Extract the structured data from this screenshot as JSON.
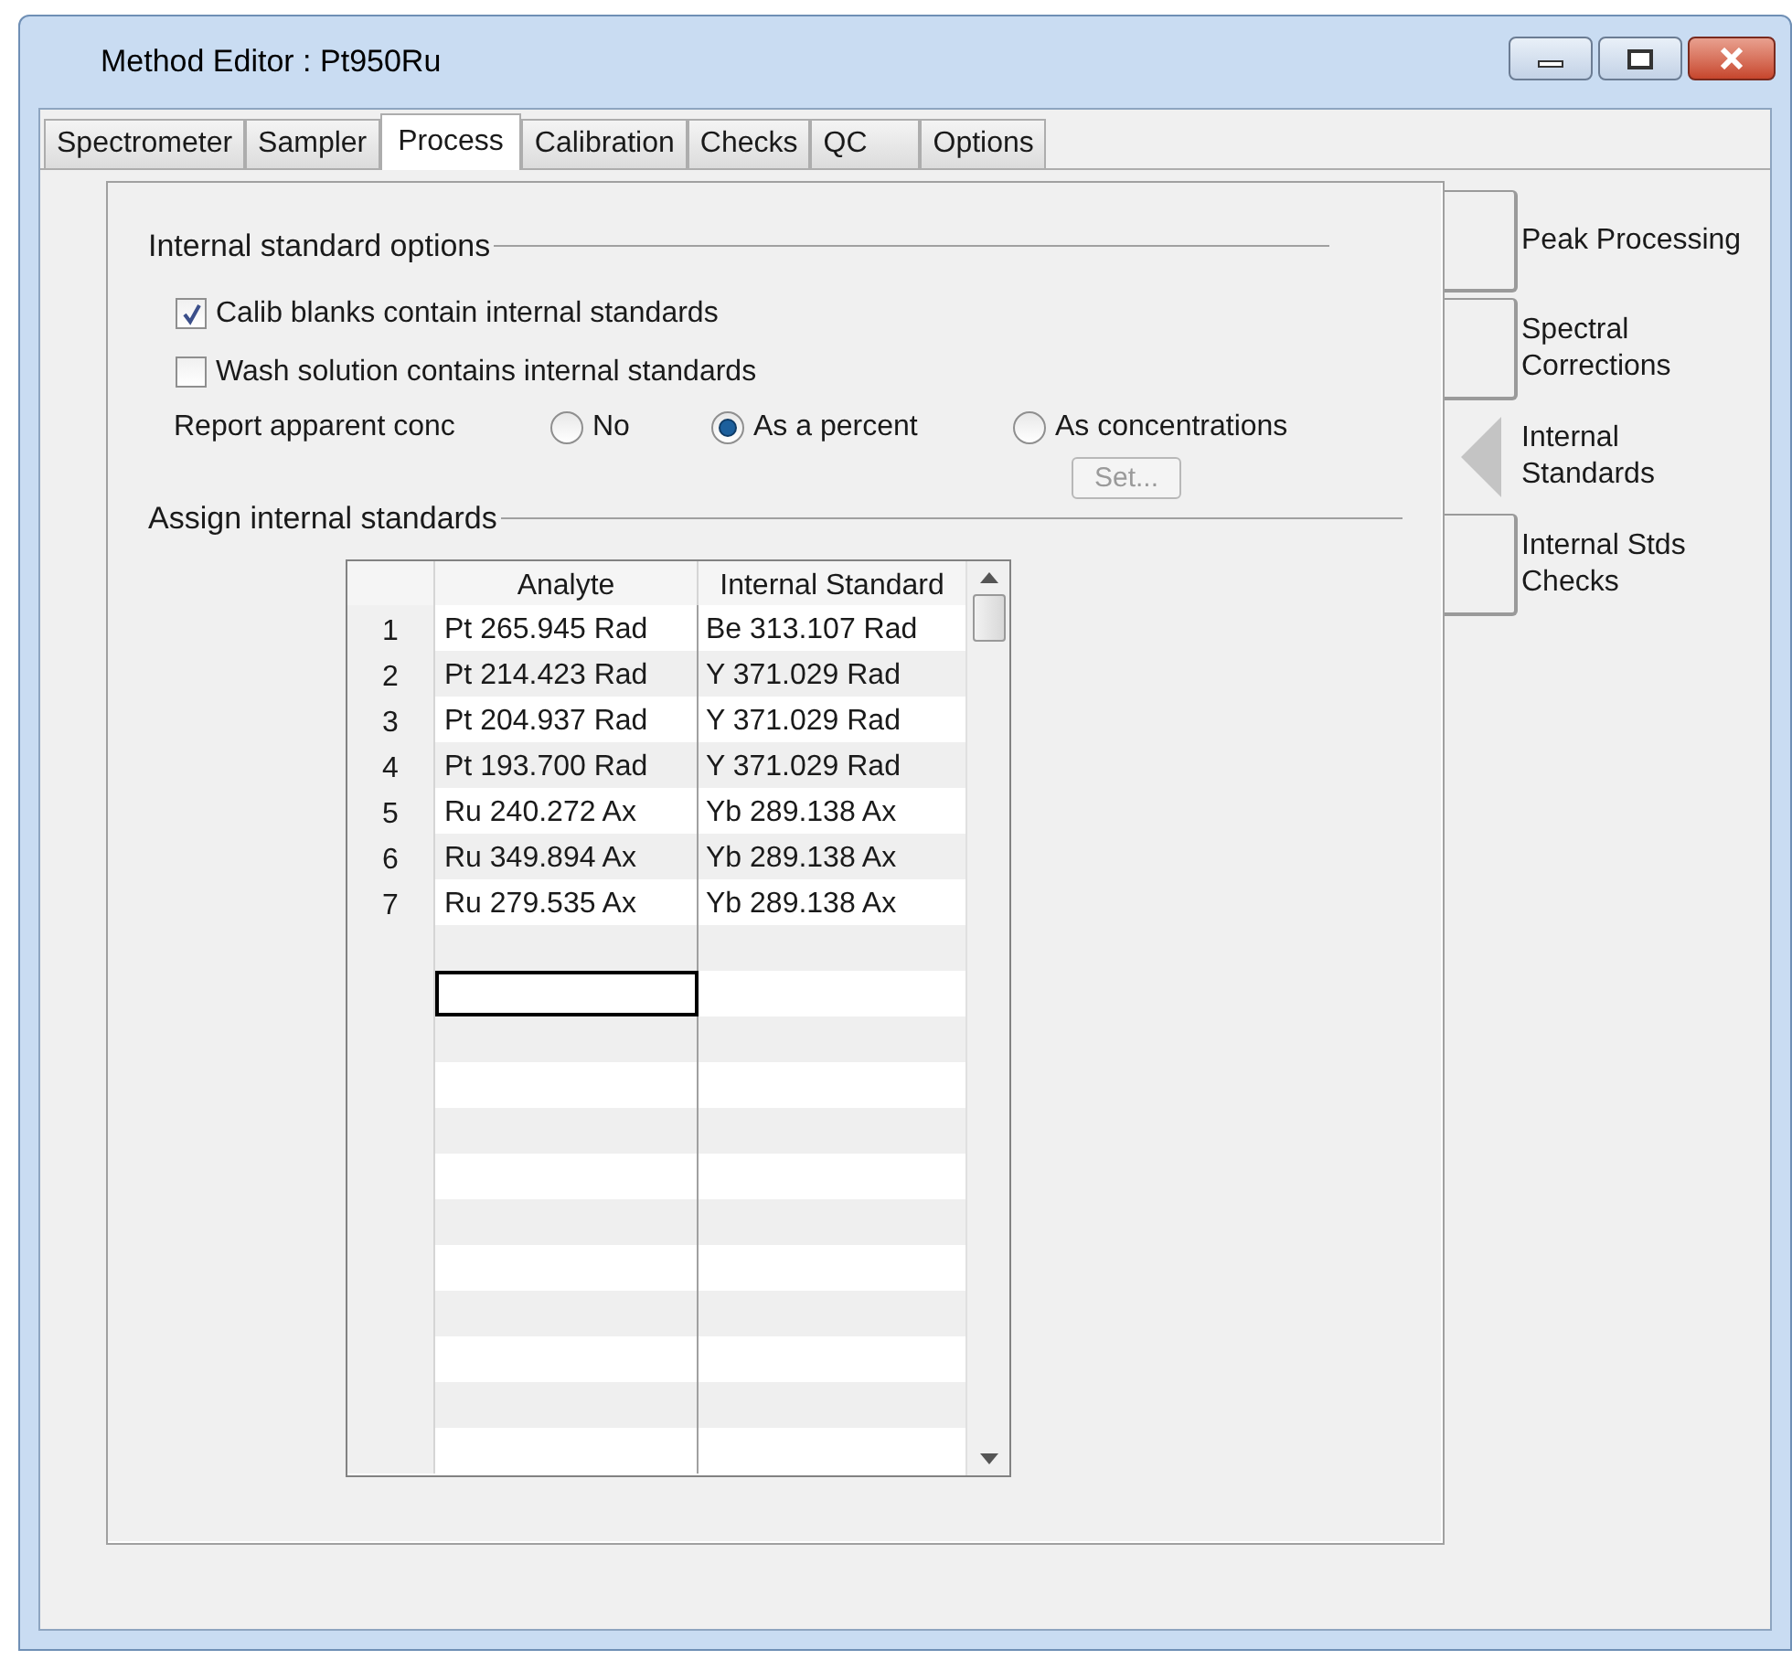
{
  "window": {
    "title": "Method Editor : Pt950Ru"
  },
  "tabs": [
    {
      "label": "Spectrometer",
      "selected": false
    },
    {
      "label": "Sampler",
      "selected": false
    },
    {
      "label": "Process",
      "selected": true
    },
    {
      "label": "Calibration",
      "selected": false
    },
    {
      "label": "Checks",
      "selected": false
    },
    {
      "label": "QC",
      "selected": false
    },
    {
      "label": "Options",
      "selected": false
    }
  ],
  "options": {
    "title": "Internal standard options",
    "checkboxes": [
      {
        "label": "Calib blanks contain internal standards",
        "checked": true
      },
      {
        "label": "Wash solution contains internal standards",
        "checked": false
      }
    ],
    "report_label": "Report apparent conc",
    "radios": [
      {
        "label": "No",
        "selected": false
      },
      {
        "label": "As a percent",
        "selected": true
      },
      {
        "label": "As concentrations",
        "selected": false
      }
    ],
    "set_button": {
      "label": "Set...",
      "disabled": true
    }
  },
  "assign": {
    "title": "Assign internal standards",
    "columns": [
      "Analyte",
      "Internal Standard"
    ],
    "rows": [
      {
        "index": "1",
        "analyte": "Pt 265.945 Rad",
        "standard": "Be 313.107 Rad"
      },
      {
        "index": "2",
        "analyte": "Pt 214.423 Rad",
        "standard": "Y 371.029 Rad"
      },
      {
        "index": "3",
        "analyte": "Pt 204.937 Rad",
        "standard": "Y 371.029 Rad"
      },
      {
        "index": "4",
        "analyte": "Pt 193.700 Rad",
        "standard": "Y 371.029 Rad"
      },
      {
        "index": "5",
        "analyte": "Ru 240.272 Ax",
        "standard": "Yb 289.138 Ax"
      },
      {
        "index": "6",
        "analyte": "Ru 349.894 Ax",
        "standard": "Yb 289.138 Ax"
      },
      {
        "index": "7",
        "analyte": "Ru 279.535 Ax",
        "standard": "Yb 289.138 Ax"
      }
    ],
    "empty_rows": [
      {
        "focused": false
      },
      {
        "focused": true
      },
      {
        "focused": false
      },
      {
        "focused": false
      },
      {
        "focused": false
      },
      {
        "focused": false
      },
      {
        "focused": false
      },
      {
        "focused": false
      },
      {
        "focused": false
      },
      {
        "focused": false
      },
      {
        "focused": false
      },
      {
        "focused": false
      }
    ]
  },
  "side_tabs": [
    {
      "label": "Peak Processing",
      "selected": false
    },
    {
      "label": "Spectral Corrections",
      "selected": false
    },
    {
      "label": "Internal Standards",
      "selected": true
    },
    {
      "label": "Internal Stds Checks",
      "selected": false
    }
  ]
}
